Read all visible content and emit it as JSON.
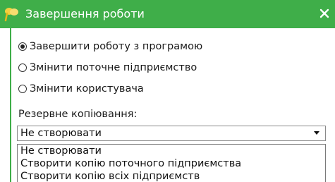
{
  "window": {
    "title": "Завершення роботи",
    "title_bar_color": "#3fae49",
    "icon": "yellow-flag-icon",
    "close_icon": "close-icon"
  },
  "options": [
    {
      "label": "Завершити роботу з програмою",
      "checked": true
    },
    {
      "label": "Змінити поточне підприємство",
      "checked": false
    },
    {
      "label": "Змінити користувача",
      "checked": false
    }
  ],
  "backup": {
    "label": "Резервне копіювання:",
    "selected": "Не створювати",
    "options": [
      "Не створювати",
      "Створити копію поточного підприємства",
      "Створити копію всіх підприємств"
    ]
  }
}
